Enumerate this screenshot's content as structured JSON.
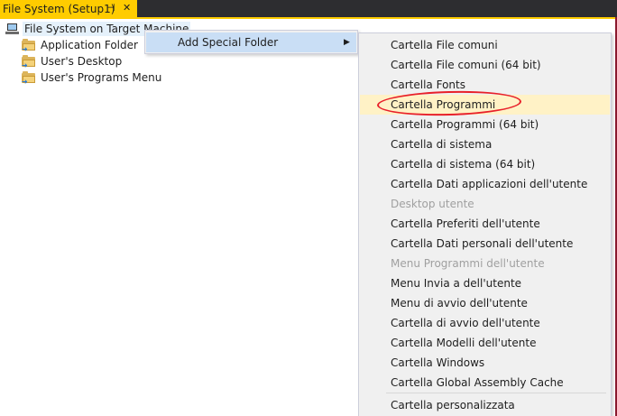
{
  "tab": {
    "title": "File System (Setup1)",
    "pin_glyph": "⊣",
    "close_glyph": "✕"
  },
  "colors": {
    "tab_active": "#ffcc00",
    "tab_bg": "#2d2d30",
    "menu_hover": "#c9def5",
    "selected": "#fff2c6",
    "annotation": "#e8202a"
  },
  "tree": {
    "root": {
      "label": "File System on Target Machine",
      "icon": "computer-icon"
    },
    "children": [
      {
        "label": "Application Folder",
        "icon": "folder-icon"
      },
      {
        "label": "User's Desktop",
        "icon": "folder-icon"
      },
      {
        "label": "User's Programs Menu",
        "icon": "folder-icon"
      }
    ]
  },
  "context_menu": {
    "item_label": "Add Special Folder",
    "submenu_arrow": "▶"
  },
  "submenu": {
    "items": [
      {
        "label": "Cartella File comuni",
        "enabled": true
      },
      {
        "label": "Cartella File comuni (64 bit)",
        "enabled": true
      },
      {
        "label": "Cartella Fonts",
        "enabled": true
      },
      {
        "label": "Cartella Programmi",
        "enabled": true,
        "selected": true
      },
      {
        "label": "Cartella Programmi (64 bit)",
        "enabled": true
      },
      {
        "label": "Cartella di sistema",
        "enabled": true
      },
      {
        "label": "Cartella di sistema (64 bit)",
        "enabled": true
      },
      {
        "label": "Cartella Dati applicazioni dell'utente",
        "enabled": true
      },
      {
        "label": "Desktop utente",
        "enabled": false
      },
      {
        "label": "Cartella Preferiti dell'utente",
        "enabled": true
      },
      {
        "label": "Cartella Dati personali dell'utente",
        "enabled": true
      },
      {
        "label": "Menu Programmi dell'utente",
        "enabled": false
      },
      {
        "label": "Menu Invia a dell'utente",
        "enabled": true
      },
      {
        "label": "Menu di avvio dell'utente",
        "enabled": true
      },
      {
        "label": "Cartella di avvio dell'utente",
        "enabled": true
      },
      {
        "label": "Cartella Modelli dell'utente",
        "enabled": true
      },
      {
        "label": "Cartella Windows",
        "enabled": true
      },
      {
        "label": "Cartella Global Assembly Cache",
        "enabled": true
      },
      {
        "label": "Cartella personalizzata",
        "enabled": true
      }
    ]
  }
}
